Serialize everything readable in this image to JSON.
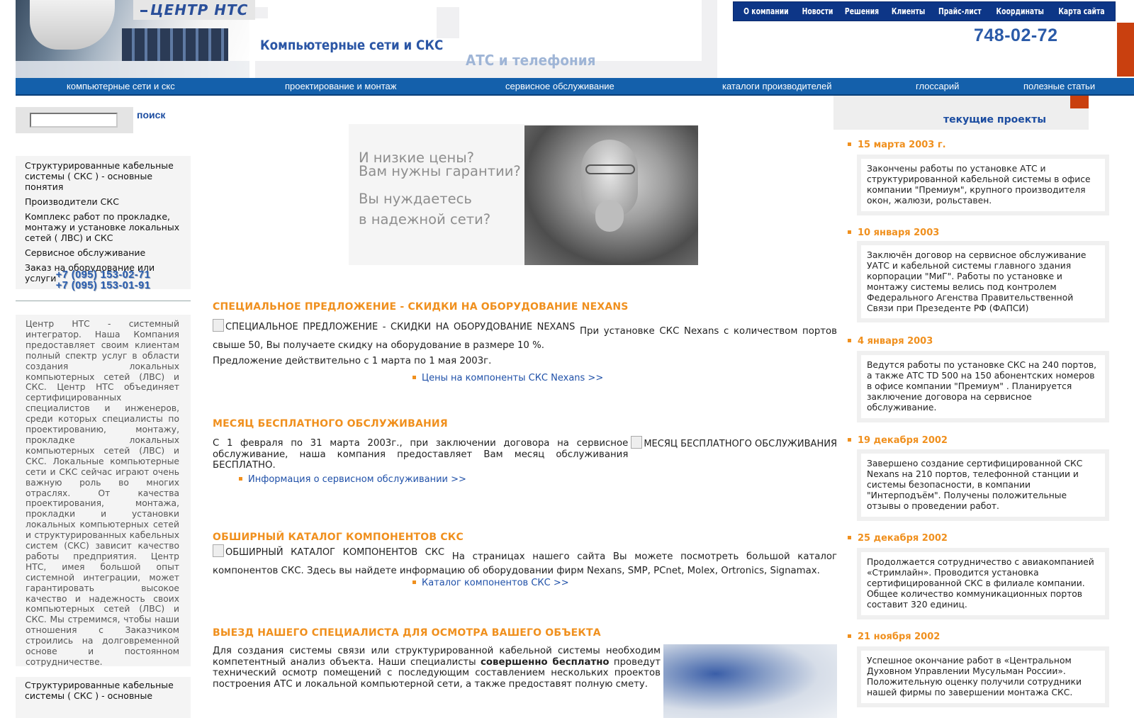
{
  "header": {
    "logo": "ЦЕНТР НТС",
    "slogan_primary": "Компьютерные сети и СКС",
    "slogan_secondary": "АТС и телефония",
    "phone": "748-02-72"
  },
  "top_nav": [
    "О компании",
    "Новости",
    "Решения",
    "Клиенты",
    "Прайс-лист",
    "Координаты",
    "Карта сайта"
  ],
  "main_nav": [
    "компьютерные сети и скс",
    "проектирование и монтаж",
    "сервисное обслуживание",
    "каталоги производителей",
    "глоссарий",
    "полезные статьи"
  ],
  "search": {
    "value": "",
    "label": "поиск"
  },
  "sidebar": {
    "items": [
      "Структурированные кабельные системы ( СКС ) - основные понятия",
      "Производители СКС",
      "Комплекс работ по прокладке, монтажу и установке локальных сетей ( ЛВС) и СКС",
      "Сервисное обслуживание",
      "Заказ на оборудование или услуги"
    ],
    "phones": [
      "+7 (095) 153-02-71",
      "+7 (095) 153-01-91"
    ],
    "about": "Центр НТС - системный интегратор. Наша Компания предоставляет своим клиентам полный спектр услуг в области создания локальных компьютерных сетей (ЛВС) и СКС. Центр НТС объединяет сертифицированных специалистов и инженеров, среди которых специалисты по проектированию, монтажу, прокладке локальных компьютерных сетей (ЛВС) и СКС. Локальные компьютерные сети и СКС сейчас играют очень важную роль во многих отраслях. От качества проектирования, монтажа, прокладки и установки локальных компьютерных сетей и структурированных кабельных систем (СКС) зависит качество работы предприятия. Центр НТС, имея большой опыт системной интеграции, может гарантировать высокое качество и надежность своих компьютерных сетей (ЛВС) и СКС. Мы стремимся, чтобы наши отношения с Заказчиком строились на долговременной основе и постоянном сотрудничестве.",
    "bottom_item": "Структурированные кабельные системы ( СКС ) - основные"
  },
  "banner": {
    "lines": [
      "И низкие цены?",
      "Вам нужны гарантии?",
      "Вы нуждаетесь",
      "в надежной сети?"
    ]
  },
  "sections": [
    {
      "title": "СПЕЦИАЛЬНОЕ ПРЕДЛОЖЕНИЕ - СКИДКИ НА ОБОРУДОВАНИЕ NEXANS",
      "img_alt": "СПЕЦИАЛЬНОЕ ПРЕДЛОЖЕНИЕ - СКИДКИ НА ОБОРУДОВАНИЕ NEXANS",
      "text": "При установке СКС Nexans с количеством портов свыше 50, Вы получаете скидку на оборудование в размере 10 %.",
      "text2": "Предложение действительно с 1 марта по 1 мая 2003г.",
      "link": "Цены на компоненты СКС Nexans >>"
    },
    {
      "title": "МЕСЯЦ БЕСПЛАТНОГО ОБСЛУЖИВАНИЯ",
      "img_alt": "МЕСЯЦ БЕСПЛАТНОГО ОБСЛУЖИВАНИЯ",
      "text": "С 1 февраля по 31 марта 2003г., при заключении договора на сервисное обслуживание, наша компания предоставляет Вам месяц обслуживания БЕСПЛАТНО.",
      "link": "Информация о сервисном обслуживании >>"
    },
    {
      "title": "ОБШИРНЫЙ КАТАЛОГ КОМПОНЕНТОВ СКС",
      "img_alt": "ОБШИРНЫЙ КАТАЛОГ КОМПОНЕНТОВ СКС",
      "text": "На страницах нашего сайта Вы можете посмотреть большой каталог компонентов СКС. Здесь вы найдете информацию об оборудовании фирм Nexans, SMP, PCnet, Molex, Ortronics, Signamax.",
      "link": "Каталог компонентов СКС >>"
    },
    {
      "title": "ВЫЕЗД НАШЕГО СПЕЦИАЛИСТА ДЛЯ ОСМОТРА ВАШЕГО ОБЪЕКТА",
      "text_a": "Для создания системы связи или структурированной кабельной системы необходим компетентный анализ объекта. Наши специалисты ",
      "text_bold": "совершенно бесплатно",
      "text_b": " проведут технический осмотр помещений с последующим составлением нескольких проектов построения АТС и локальной компьютерной сети, а также предоставят полную смету."
    }
  ],
  "projects": {
    "title": "текущие проекты",
    "items": [
      {
        "date": "15 марта 2003 г.",
        "text": "Закончены работы по установке АТС и структурированной кабельной системы в офисе компании \"Премиум\", крупного производителя окон, жалюзи, рольставен."
      },
      {
        "date": "10 января 2003",
        "text": "Заключён договор на сервисное обслуживание УАТС и кабельной системы главного здания корпорации \"МиГ\". Работы по установке и монтажу системы велись под контролем Федерального Агенства Правительственной Связи при Презеденте РФ (ФАПСИ)"
      },
      {
        "date": "4 января 2003",
        "text": "Ведутся работы по установке СКС на 240 портов, а также АТС TD 500 на 150 абонентских номеров в офисе компании \"Премиум\" . Планируется заключение договора на сервисное обслуживание."
      },
      {
        "date": "19 декабря 2002",
        "text": "Завершено создание сертифицированной СКС Nexans на 210 портов, телефонной станции и системы безопасности, в компании \"Интерподъём\". Получены положительные отзывы о проведении работ."
      },
      {
        "date": "25 декабря 2002",
        "text": "Продолжается сотрудничество с авиакомпанией «Стримлайн». Проводится установка сертифицированной СКС в филиале компании. Общее количество коммуникационных портов составит 320 единиц."
      },
      {
        "date": "21 ноября 2002",
        "text": "Успешное окончание работ в «Центральном Духовном Управлении Мусульман России». Положительную оценку получили сотрудники нашей фирмы по завершении монтажа СКС."
      }
    ]
  },
  "colors": {
    "nav_blue": "#1460ab",
    "top_nav": "#0d3687",
    "accent_orange": "#f0901e",
    "link_blue": "#1f50a8",
    "brand_red": "#c9400f"
  }
}
